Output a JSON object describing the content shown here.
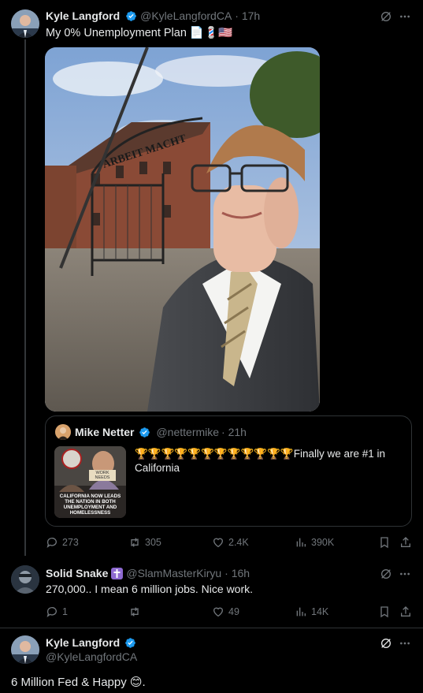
{
  "tweet1": {
    "name": "Kyle Langford",
    "handle": "@KyleLangfordCA",
    "time": "· 17h",
    "text": "My 0% Unemployment Plan 📄💈🇺🇸",
    "image_sign_text": "ARBEIT MACHT",
    "quote": {
      "name": "Mike Netter",
      "handle": "@nettermike",
      "time": "· 21h",
      "text": "🏆🏆🏆🏆🏆🏆🏆🏆🏆🏆🏆🏆Finally we are #1 in California",
      "thumb_caption": "CALIFORNIA NOW LEADS THE NATION IN BOTH UNEMPLOYMENT AND HOMELESSNESS",
      "thumb_sign": "WORK NEEDS"
    },
    "stats": {
      "replies": "273",
      "reposts": "305",
      "likes": "2.4K",
      "views": "390K"
    }
  },
  "tweet2": {
    "name": "Solid Snake",
    "handle": "@SlamMasterKiryu",
    "time": "· 16h",
    "badge": "✝️",
    "text": "270,000.. I mean 6 million jobs. Nice work.",
    "stats": {
      "replies": "1",
      "reposts": "",
      "likes": "49",
      "views": "14K"
    }
  },
  "tweet3": {
    "name": "Kyle Langford",
    "handle": "@KyleLangfordCA",
    "text": "6 Million Fed & Happy 😊."
  },
  "colors": {
    "accent": "#1d9bf0",
    "muted": "#71767b",
    "bg": "#000000",
    "border": "#2f3336"
  }
}
